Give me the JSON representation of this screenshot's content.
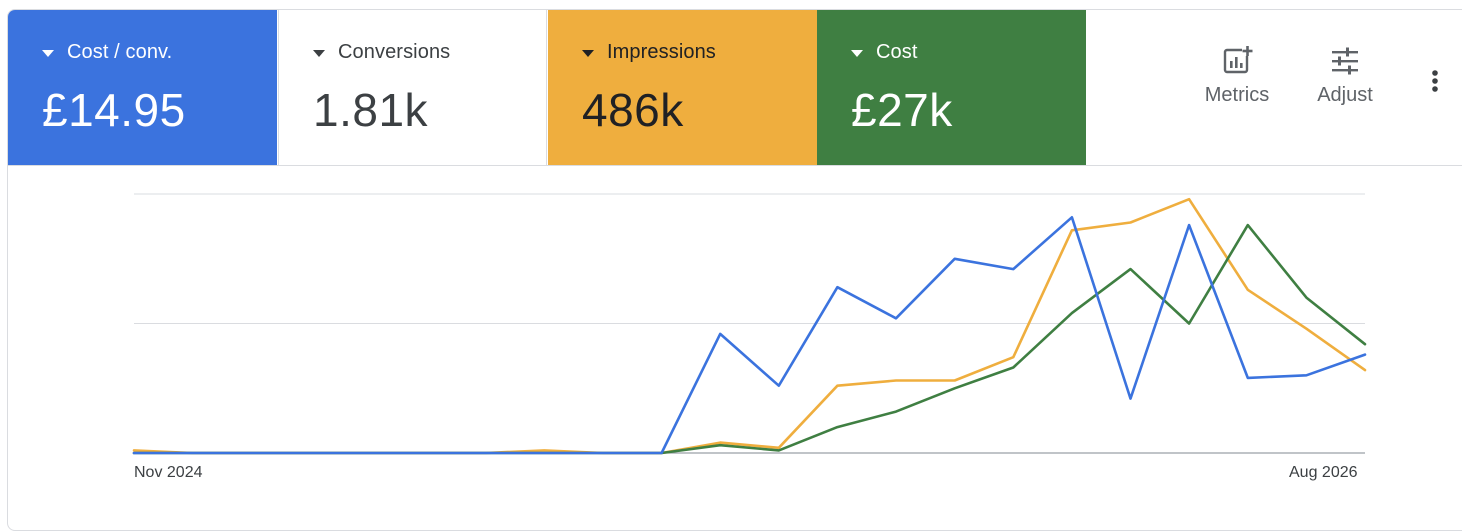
{
  "scorecards": [
    {
      "label": "Cost / conv.",
      "value": "£14.95",
      "color": "#3b73de"
    },
    {
      "label": "Conversions",
      "value": "1.81k",
      "color": "#ffffff"
    },
    {
      "label": "Impressions",
      "value": "486k",
      "color": "#efae3e"
    },
    {
      "label": "Cost",
      "value": "£27k",
      "color": "#3f7f42"
    }
  ],
  "toolbar": {
    "metrics_label": "Metrics",
    "adjust_label": "Adjust",
    "metrics_icon": "add-chart-icon",
    "adjust_icon": "tune-icon",
    "more_icon": "more-vert-icon"
  },
  "chart_data": {
    "type": "line",
    "x_start_label": "Nov 2024",
    "x_end_label": "Aug 2026",
    "grid": true,
    "y_scale": "normalized per series, 0-100",
    "ylim": [
      0,
      100
    ],
    "series": [
      {
        "color": "#3b73de",
        "values": [
          0,
          0,
          0,
          0,
          0,
          0,
          0,
          0,
          0,
          0,
          46,
          26,
          64,
          52,
          75,
          71,
          91,
          21,
          88,
          29,
          30,
          38
        ]
      },
      {
        "color": "#efae3e",
        "values": [
          1,
          0,
          0,
          0,
          0,
          0,
          0,
          1,
          0,
          0,
          4,
          2,
          26,
          28,
          28,
          37,
          86,
          89,
          98,
          63,
          48,
          32
        ]
      },
      {
        "color": "#3f7f42",
        "values": [
          0,
          0,
          0,
          0,
          0,
          0,
          0,
          0,
          0,
          0,
          3,
          1,
          10,
          16,
          25,
          33,
          54,
          71,
          50,
          88,
          60,
          42
        ]
      }
    ]
  }
}
